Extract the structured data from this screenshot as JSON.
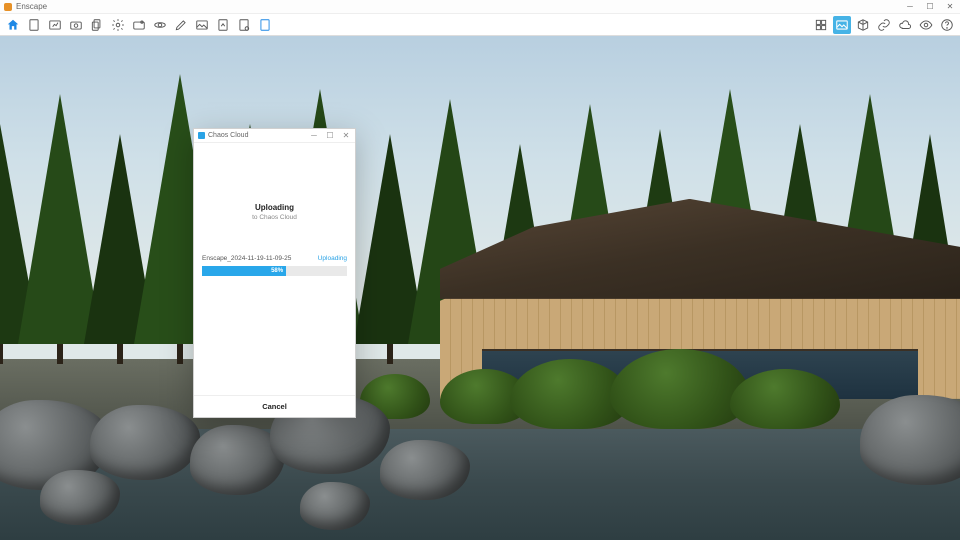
{
  "app": {
    "title": "Enscape"
  },
  "dialog": {
    "title": "Chaos Cloud",
    "heading": "Uploading",
    "subheading": "to Chaos Cloud",
    "filename": "Enscape_2024-11-19-11-09-25",
    "status": "Uploading",
    "progress_percent": 58,
    "progress_label": "58%",
    "cancel": "Cancel"
  }
}
